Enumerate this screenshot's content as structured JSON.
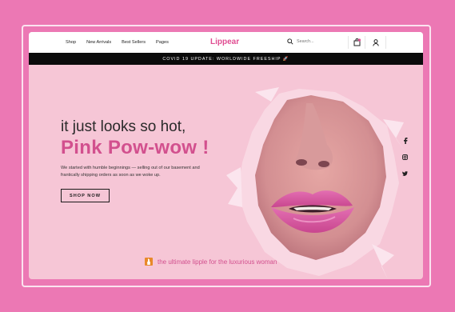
{
  "nav": {
    "links": [
      "Shop",
      "New Arrivals",
      "Best Sellers",
      "Pages"
    ],
    "logo": "Lippear",
    "search_placeholder": "Search...",
    "icons": [
      "search-icon",
      "bag-icon",
      "user-icon"
    ]
  },
  "banner": {
    "text": "COVID 19 UPDATE: WORLDWIDE FREESHIP 🚀"
  },
  "hero": {
    "tagline": "it just looks so hot,",
    "headline": "Pink Pow-wow !",
    "description": "We started with humble beginnings — selling out of our basement and frantically shipping orders as soon as we woke up.",
    "cta": "SHOP NOW",
    "footer_note": "the ultimate lipple for the luxurious woman"
  },
  "social": [
    "facebook-icon",
    "instagram-icon",
    "twitter-icon"
  ],
  "colors": {
    "page_bg": "#ec78b4",
    "hero_bg": "#f6c6d6",
    "accent": "#d2508e",
    "banner_bg": "#0b0b0b"
  }
}
